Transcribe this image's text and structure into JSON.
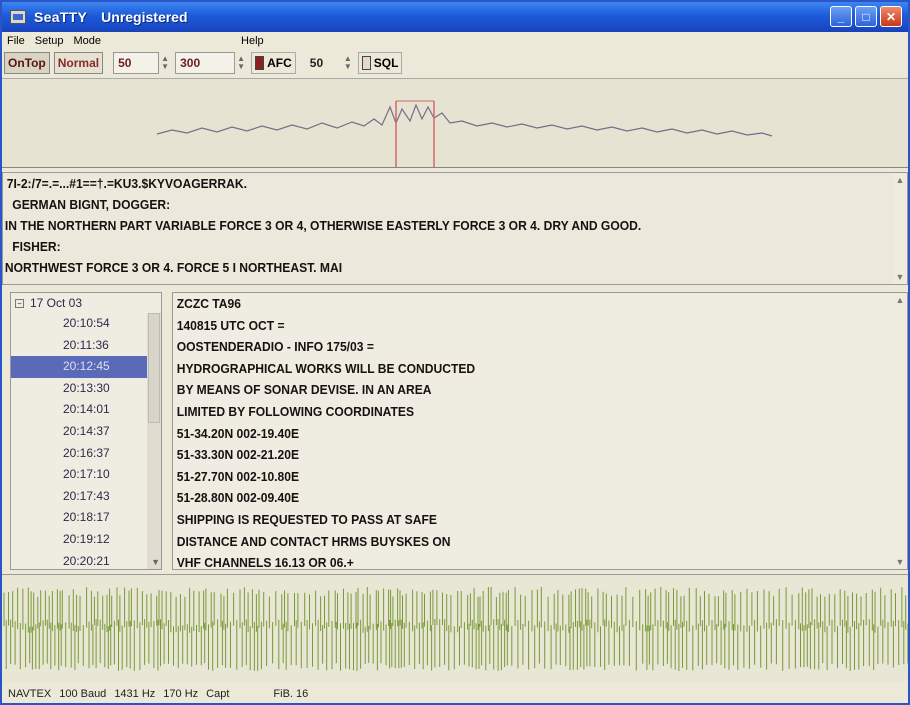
{
  "window": {
    "title": "SeaTTY",
    "registration": "Unregistered"
  },
  "menu": {
    "items": [
      "File",
      "Setup",
      "Mode"
    ],
    "help": "Help"
  },
  "toolbar": {
    "ontop_label": "OnTop",
    "normal_label": "Normal",
    "spin1_value": "50",
    "spin2_value": "300",
    "afc_label": "AFC",
    "afc_checked": true,
    "squelch_value": "50",
    "sql_label": "SQL",
    "sql_checked": false
  },
  "decoded_text": {
    "lines": [
      "7I-2:/7=.=...#1==†.=KU3.$KYVOAGERRAK.",
      "GERMAN BIGNT, DOGGER:",
      "IN THE NORTHERN PART VARIABLE FORCE 3 OR 4, OTHERWISE EASTERLY FORCE 3 OR 4. DRY AND GOOD.",
      "FISHER:",
      "NORTHWEST FORCE 3 OR 4. FORCE 5 I NORTHEAST. MAI"
    ]
  },
  "message_tree": {
    "date": "17 Oct 03",
    "times": [
      "20:10:54",
      "20:11:36",
      "20:12:45",
      "20:13:30",
      "20:14:01",
      "20:14:37",
      "20:16:37",
      "20:17:10",
      "20:17:43",
      "20:18:17",
      "20:19:12",
      "20:20:21"
    ],
    "selected_index": 2
  },
  "message": {
    "lines": [
      "ZCZC TA96",
      "140815 UTC OCT =",
      "OOSTENDERADIO - INFO 175/03 =",
      "HYDROGRAPHICAL WORKS WILL BE CONDUCTED",
      "BY MEANS OF SONAR DEVISE. IN AN AREA",
      "LIMITED BY FOLLOWING COORDINATES",
      "51-34.20N 002-19.40E",
      "51-33.30N 002-21.20E",
      "51-27.70N 002-10.80E",
      "51-28.80N 002-09.40E",
      "SHIPPING IS REQUESTED TO PASS AT SAFE",
      "DISTANCE AND CONTACT HRMS BUYSKES ON",
      "VHF CHANNELS 16.13 OR 06.+"
    ]
  },
  "status": {
    "mode": "NAVTEX",
    "baud": "100 Baud",
    "freq": "1431 Hz",
    "shift": "170 Hz",
    "capt": "Capt",
    "fib": "FiB. 16"
  },
  "colors": {
    "titlebar": "#1d5bd8",
    "text": "#1a1010",
    "selection": "#5a6ab8",
    "spectrum_trace": "#7a6a8a",
    "marker": "#d06a6a",
    "waveform": "#7a9a3a"
  }
}
